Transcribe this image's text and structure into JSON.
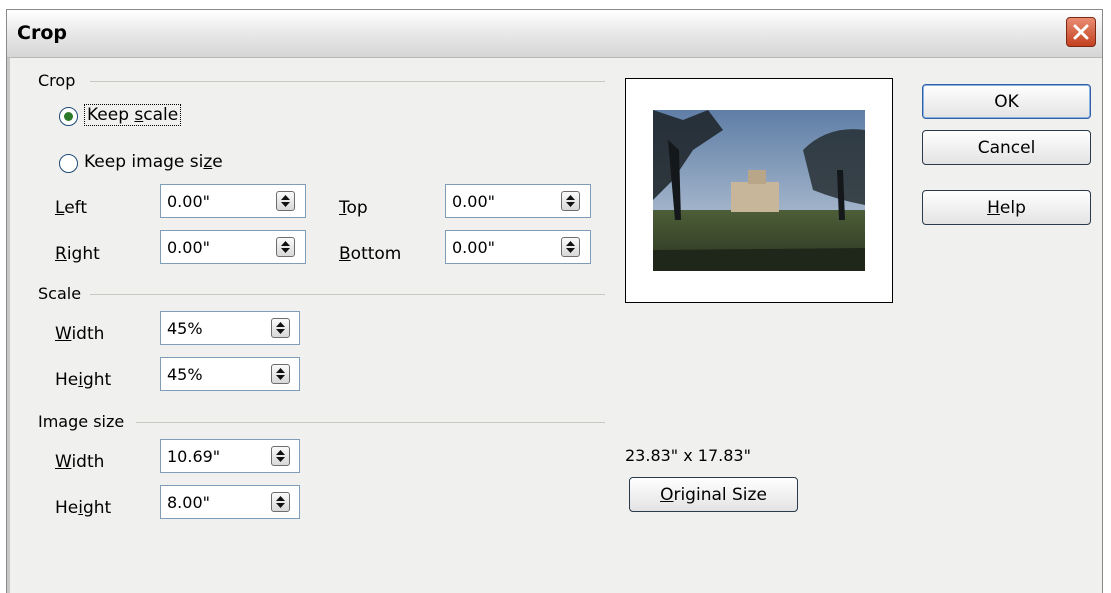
{
  "window": {
    "title": "Crop"
  },
  "crop_group": {
    "label": "Crop",
    "keep_scale": {
      "label_pre": "Keep ",
      "label_acc": "s",
      "label_post": "cale",
      "selected": true
    },
    "keep_size": {
      "label_pre": "Keep image si",
      "label_acc": "z",
      "label_post": "e",
      "selected": false
    },
    "left": {
      "acc": "L",
      "rest": "eft",
      "value": "0.00\""
    },
    "right": {
      "acc": "R",
      "rest": "ight",
      "value": "0.00\""
    },
    "top": {
      "acc": "T",
      "rest": "op",
      "value": "0.00\""
    },
    "bottom": {
      "acc": "B",
      "rest": "ottom",
      "value": "0.00\""
    }
  },
  "scale_group": {
    "label": "Scale",
    "width": {
      "acc": "W",
      "rest": "idth",
      "value": "45%"
    },
    "height": {
      "pre": "He",
      "acc": "i",
      "rest": "ght",
      "value": "45%"
    }
  },
  "size_group": {
    "label": "Image size",
    "width": {
      "acc": "W",
      "rest": "idth",
      "value": "10.69\""
    },
    "height": {
      "pre": "He",
      "acc": "i",
      "rest": "ght",
      "value": "8.00\""
    }
  },
  "original_dimensions": "23.83\" x 17.83\"",
  "buttons": {
    "ok": "OK",
    "cancel": "Cancel",
    "help_acc": "H",
    "help_rest": "elp",
    "original_acc": "O",
    "original_rest": "riginal Size"
  },
  "colors": {
    "radio_dot": "#2a7a2a",
    "close": "#c3411f",
    "default_button": "#2e5fa8"
  }
}
